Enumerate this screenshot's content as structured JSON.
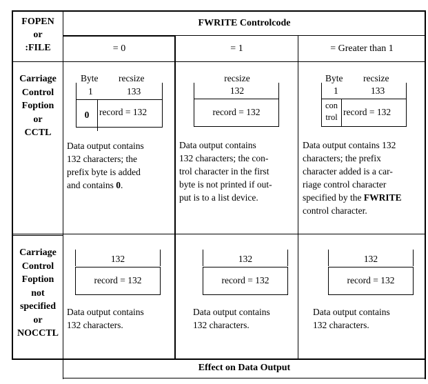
{
  "corner_header": {
    "line1": "FOPEN",
    "line2": "or",
    "line3": ":FILE"
  },
  "top_header": "FWRITE Controlcode",
  "columns": [
    {
      "label": "= 0"
    },
    {
      "label": "= 1"
    },
    {
      "label": "= Greater than 1"
    }
  ],
  "rows": [
    {
      "header": [
        "Carriage",
        "Control",
        "Foption",
        "or",
        "CCTL"
      ],
      "cells": [
        {
          "diagram": {
            "byte_label": "Byte",
            "size_label": "recsize",
            "byte_num": "1",
            "size_num": "133",
            "prefix": "0",
            "record": "record = 132"
          },
          "text": [
            "Data output contains",
            "132 characters; the",
            "prefix byte is added",
            "and contains 0."
          ]
        },
        {
          "diagram": {
            "size_label": "recsize",
            "size_num": "132",
            "record": "record = 132"
          },
          "text": [
            "Data output contains",
            "132 characters; the con-",
            "trol character in the first",
            "byte is not printed if out-",
            "put is to a list device."
          ]
        },
        {
          "diagram": {
            "byte_label": "Byte",
            "size_label": "recsize",
            "byte_num": "1",
            "size_num": "133",
            "prefix_line1": "con",
            "prefix_line2": "trol",
            "record": "record = 132"
          },
          "text": [
            "Data output contains 132",
            "characters; the prefix",
            "character added is a car-",
            "riage control character",
            "specified by the FWRITE",
            "control character."
          ]
        }
      ]
    },
    {
      "header": [
        "Carriage",
        "Control",
        "Foption",
        "not",
        "specified",
        "or",
        "NOCCTL"
      ],
      "cells": [
        {
          "diagram": {
            "size_num": "132",
            "record": "record = 132"
          },
          "text": [
            "Data output contains",
            "132 characters."
          ]
        },
        {
          "diagram": {
            "size_num": "132",
            "record": "record = 132"
          },
          "text": [
            "Data output contains",
            "132 characters."
          ]
        },
        {
          "diagram": {
            "size_num": "132",
            "record": "record = 132"
          },
          "text": [
            "Data output contains",
            "132 characters."
          ]
        }
      ]
    }
  ],
  "footer": "Effect on Data Output"
}
